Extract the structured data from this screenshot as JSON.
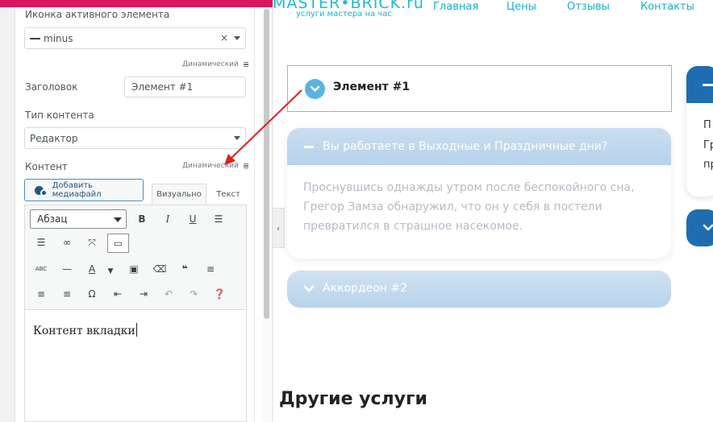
{
  "editor_panel": {
    "active_icon_label": "Иконка активного элемента",
    "active_icon_value": "minus",
    "dynamic_label": "Динамический",
    "title_label": "Заголовок",
    "title_value": "Элемент #1",
    "content_type_label": "Тип контента",
    "content_type_value": "Редактор",
    "content_label": "Контент",
    "add_media_label": "Добавить медиафайл",
    "tab_visual": "Визуально",
    "tab_text": "Текст",
    "paragraph_format": "Абзац",
    "editor_content": "Контент вкладки"
  },
  "site": {
    "logo": "MASTER•BRICK.ru",
    "logo_subtitle": "услуги мастера на час",
    "nav": [
      "Главная",
      "Цены",
      "Отзывы",
      "Контакты"
    ],
    "accordion": {
      "active_item_title": "Элемент #1",
      "open_item_title": "Вы работаете в Выходные и Праздничные дни?",
      "open_item_text": "Проснувшись однажды утром после беспокойного сна, Грегор Замза обнаружил, что он у себя в постели превратился в страшное насекомое.",
      "closed_item_title": "Аккордеон #2"
    },
    "side_text": [
      "П",
      "Гр",
      "пр"
    ],
    "section_title": "Другие услуги"
  },
  "colors": {
    "admin_bar": "#d9175e",
    "accent": "#19b0c7",
    "arrow": "#e0201b",
    "accordion_header": "#b6d2ea"
  }
}
